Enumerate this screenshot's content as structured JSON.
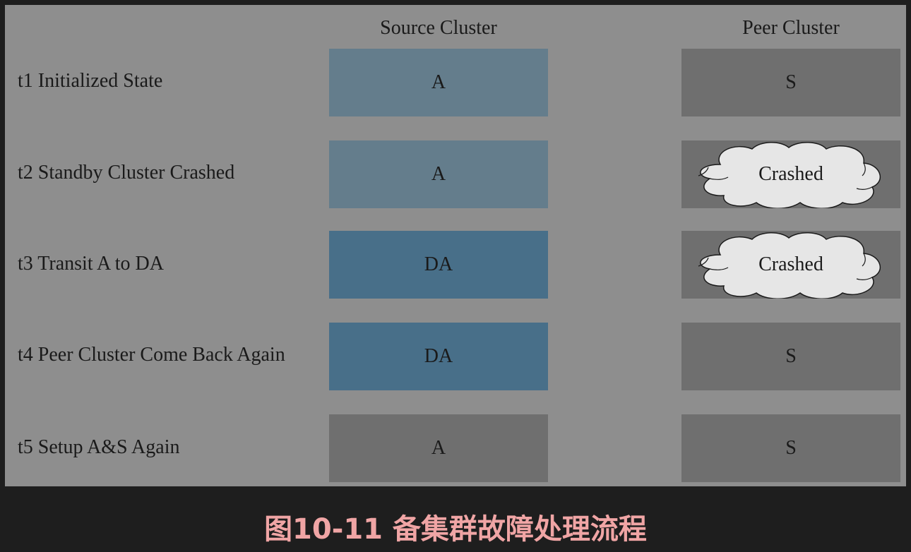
{
  "headers": {
    "source": "Source Cluster",
    "peer": "Peer Cluster"
  },
  "rows": [
    {
      "label": "t1 Initialized State",
      "source": "A",
      "source_state": "active",
      "peer": "S",
      "peer_state": "standby"
    },
    {
      "label": "t2 Standby Cluster Crashed",
      "source": "A",
      "source_state": "active",
      "peer": "Crashed",
      "peer_state": "crashed"
    },
    {
      "label": "t3 Transit A to DA",
      "source": "DA",
      "source_state": "downgraded-active",
      "peer": "Crashed",
      "peer_state": "crashed"
    },
    {
      "label": "t4 Peer Cluster Come Back Again",
      "source": "DA",
      "source_state": "downgraded-active",
      "peer": "S",
      "peer_state": "standby"
    },
    {
      "label": "t5 Setup A&S Again",
      "source": "A",
      "source_state": "normal",
      "peer": "S",
      "peer_state": "standby"
    }
  ],
  "colors": {
    "background": "#8e8e8e",
    "active": "#647d8c",
    "downgraded_active": "#486f89",
    "gray": "#6f6f6f",
    "cloud_fill": "#e6e6e6",
    "caption": "#f0a5a5"
  },
  "caption": "图10-11 备集群故障处理流程"
}
